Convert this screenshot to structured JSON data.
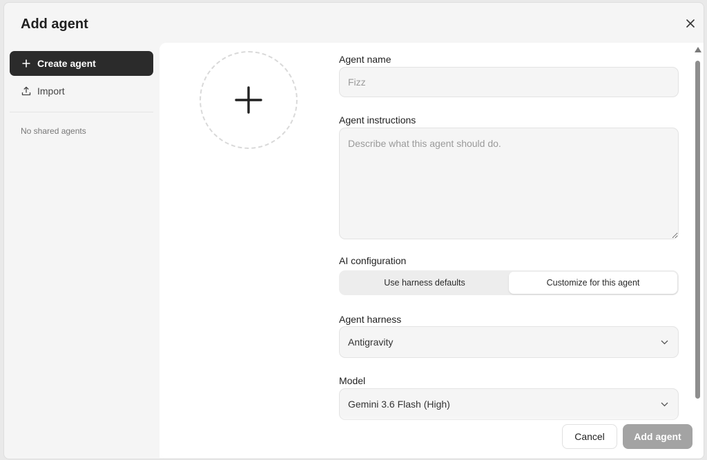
{
  "dialog": {
    "title": "Add agent"
  },
  "sidebar": {
    "items": [
      {
        "label": "Create agent",
        "icon": "plus-icon"
      },
      {
        "label": "Import",
        "icon": "upload-icon"
      }
    ],
    "empty_text": "No shared agents"
  },
  "form": {
    "name_label": "Agent name",
    "name_placeholder": "Fizz",
    "instructions_label": "Agent instructions",
    "instructions_placeholder": "Describe what this agent should do.",
    "ai_config_label": "AI configuration",
    "ai_config_options": [
      "Use harness defaults",
      "Customize for this agent"
    ],
    "ai_config_selected": "Customize for this agent",
    "harness_label": "Agent harness",
    "harness_value": "Antigravity",
    "model_label": "Model",
    "model_value": "Gemini 3.6 Flash (High)"
  },
  "footer": {
    "cancel_label": "Cancel",
    "add_label": "Add agent"
  },
  "colors": {
    "primary_dark": "#2b2b2b",
    "disabled_button": "#a3a3a3",
    "panel_bg": "#ffffff",
    "dialog_bg": "#f5f5f5"
  }
}
